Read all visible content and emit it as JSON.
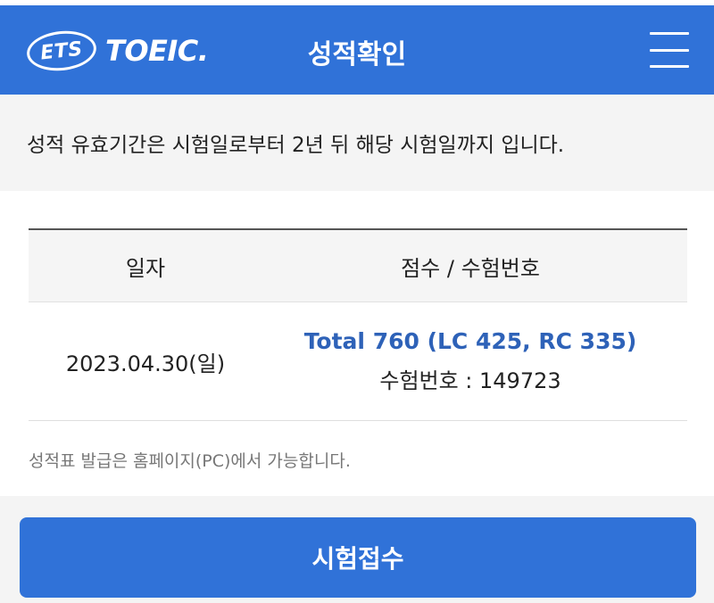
{
  "header": {
    "logo_ets": "ETS",
    "logo_toeic": "TOEIC.",
    "title": "성적확인",
    "menu_icon": "hamburger-menu-icon"
  },
  "notice": {
    "text": "성적 유효기간은 시험일로부터 2년 뒤 해당 시험일까지 입니다."
  },
  "table": {
    "headers": [
      "일자",
      "점수 / 수험번호"
    ],
    "rows": [
      {
        "date": "2023.04.30(일)",
        "score": "Total 760 (LC 425, RC 335)",
        "exam_number": "수험번호 : 149723"
      }
    ]
  },
  "issue_note": "성적표 발급은 홈페이지(PC)에서 가능합니다.",
  "apply_button": "시험접수",
  "colors": {
    "brand_blue": "#3072d8",
    "score_blue": "#2e62b8"
  }
}
